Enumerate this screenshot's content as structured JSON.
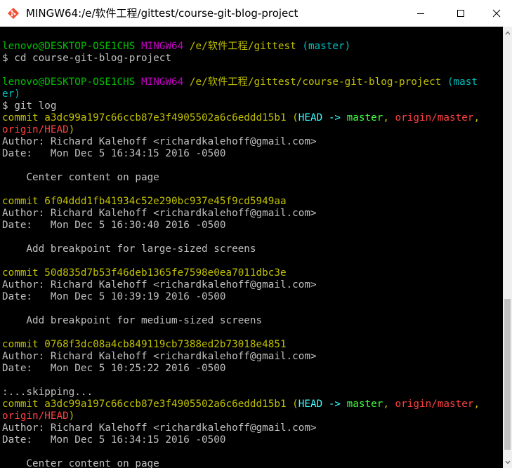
{
  "window": {
    "title": "MINGW64:/e/软件工程/gittest/course-git-blog-project",
    "icon": "git-bash-icon"
  },
  "controls": {
    "minimize_icon": "minimize-icon",
    "maximize_icon": "maximize-icon",
    "close_icon": "close-icon"
  },
  "colors": {
    "background": "#000000",
    "prompt_user": "#00c000",
    "prompt_env": "#c000c0",
    "prompt_path": "#c0c000",
    "prompt_branch": "#00c0c0",
    "commit_hash": "#c0c000",
    "ref_head": "#40ffff",
    "ref_local": "#40ff40",
    "ref_remote": "#ff4040",
    "text": "#c0c0c0"
  },
  "terminal": {
    "lines": [
      [],
      [
        {
          "t": "lenovo@DESKTOP-OSE1CHS ",
          "c": "green"
        },
        {
          "t": "MINGW64 ",
          "c": "magenta"
        },
        {
          "t": "/e/软件工程/gittest ",
          "c": "yellow"
        },
        {
          "t": "(master)",
          "c": "cyan"
        }
      ],
      [
        {
          "t": "$ cd course-git-blog-project",
          "c": "white"
        }
      ],
      [],
      [
        {
          "t": "lenovo@DESKTOP-OSE1CHS ",
          "c": "green"
        },
        {
          "t": "MINGW64 ",
          "c": "magenta"
        },
        {
          "t": "/e/软件工程/gittest/course-git-blog-project ",
          "c": "yellow"
        },
        {
          "t": "(mast",
          "c": "cyan"
        }
      ],
      [
        {
          "t": "er)",
          "c": "cyan"
        }
      ],
      [
        {
          "t": "$ git log",
          "c": "white"
        }
      ],
      [
        {
          "t": "commit a3dc99a197c66ccb87e3f4905502a6c6eddd15b1 ",
          "c": "yellow"
        },
        {
          "t": "(",
          "c": "yellow"
        },
        {
          "t": "HEAD -> ",
          "c": "bcyan"
        },
        {
          "t": "master",
          "c": "bgreen"
        },
        {
          "t": ", ",
          "c": "yellow"
        },
        {
          "t": "origin/master",
          "c": "bred"
        },
        {
          "t": ",",
          "c": "yellow"
        }
      ],
      [
        {
          "t": "origin/HEAD",
          "c": "bred"
        },
        {
          "t": ")",
          "c": "yellow"
        }
      ],
      [
        {
          "t": "Author: Richard Kalehoff <richardkalehoff@gmail.com>",
          "c": "white"
        }
      ],
      [
        {
          "t": "Date:   Mon Dec 5 16:34:15 2016 -0500",
          "c": "white"
        }
      ],
      [],
      [
        {
          "t": "    Center content on page",
          "c": "white"
        }
      ],
      [],
      [
        {
          "t": "commit 6f04ddd1fb41934c52e290bc937e45f9cd5949aa",
          "c": "yellow"
        }
      ],
      [
        {
          "t": "Author: Richard Kalehoff <richardkalehoff@gmail.com>",
          "c": "white"
        }
      ],
      [
        {
          "t": "Date:   Mon Dec 5 16:30:40 2016 -0500",
          "c": "white"
        }
      ],
      [],
      [
        {
          "t": "    Add breakpoint for large-sized screens",
          "c": "white"
        }
      ],
      [],
      [
        {
          "t": "commit 50d835d7b53f46deb1365fe7598e0ea7011dbc3e",
          "c": "yellow"
        }
      ],
      [
        {
          "t": "Author: Richard Kalehoff <richardkalehoff@gmail.com>",
          "c": "white"
        }
      ],
      [
        {
          "t": "Date:   Mon Dec 5 10:39:19 2016 -0500",
          "c": "white"
        }
      ],
      [],
      [
        {
          "t": "    Add breakpoint for medium-sized screens",
          "c": "white"
        }
      ],
      [],
      [
        {
          "t": "commit 0768f3dc08a4cb849119cb7388ed2b73018e4851",
          "c": "yellow"
        }
      ],
      [
        {
          "t": "Author: Richard Kalehoff <richardkalehoff@gmail.com>",
          "c": "white"
        }
      ],
      [
        {
          "t": "Date:   Mon Dec 5 10:25:22 2016 -0500",
          "c": "white"
        }
      ],
      [],
      [
        {
          "t": ":...skipping...",
          "c": "white"
        }
      ],
      [
        {
          "t": "commit a3dc99a197c66ccb87e3f4905502a6c6eddd15b1 ",
          "c": "yellow"
        },
        {
          "t": "(",
          "c": "yellow"
        },
        {
          "t": "HEAD -> ",
          "c": "bcyan"
        },
        {
          "t": "master",
          "c": "bgreen"
        },
        {
          "t": ", ",
          "c": "yellow"
        },
        {
          "t": "origin/master",
          "c": "bred"
        },
        {
          "t": ",",
          "c": "yellow"
        }
      ],
      [
        {
          "t": "origin/HEAD",
          "c": "bred"
        },
        {
          "t": ")",
          "c": "yellow"
        }
      ],
      [
        {
          "t": "Author: Richard Kalehoff <richardkalehoff@gmail.com>",
          "c": "white"
        }
      ],
      [
        {
          "t": "Date:   Mon Dec 5 16:34:15 2016 -0500",
          "c": "white"
        }
      ],
      [],
      [
        {
          "t": "    Center content on page",
          "c": "white"
        }
      ]
    ]
  },
  "scrollbar": {
    "up_icon": "scroll-up-arrow-icon",
    "down_icon": "scroll-down-arrow-icon"
  }
}
